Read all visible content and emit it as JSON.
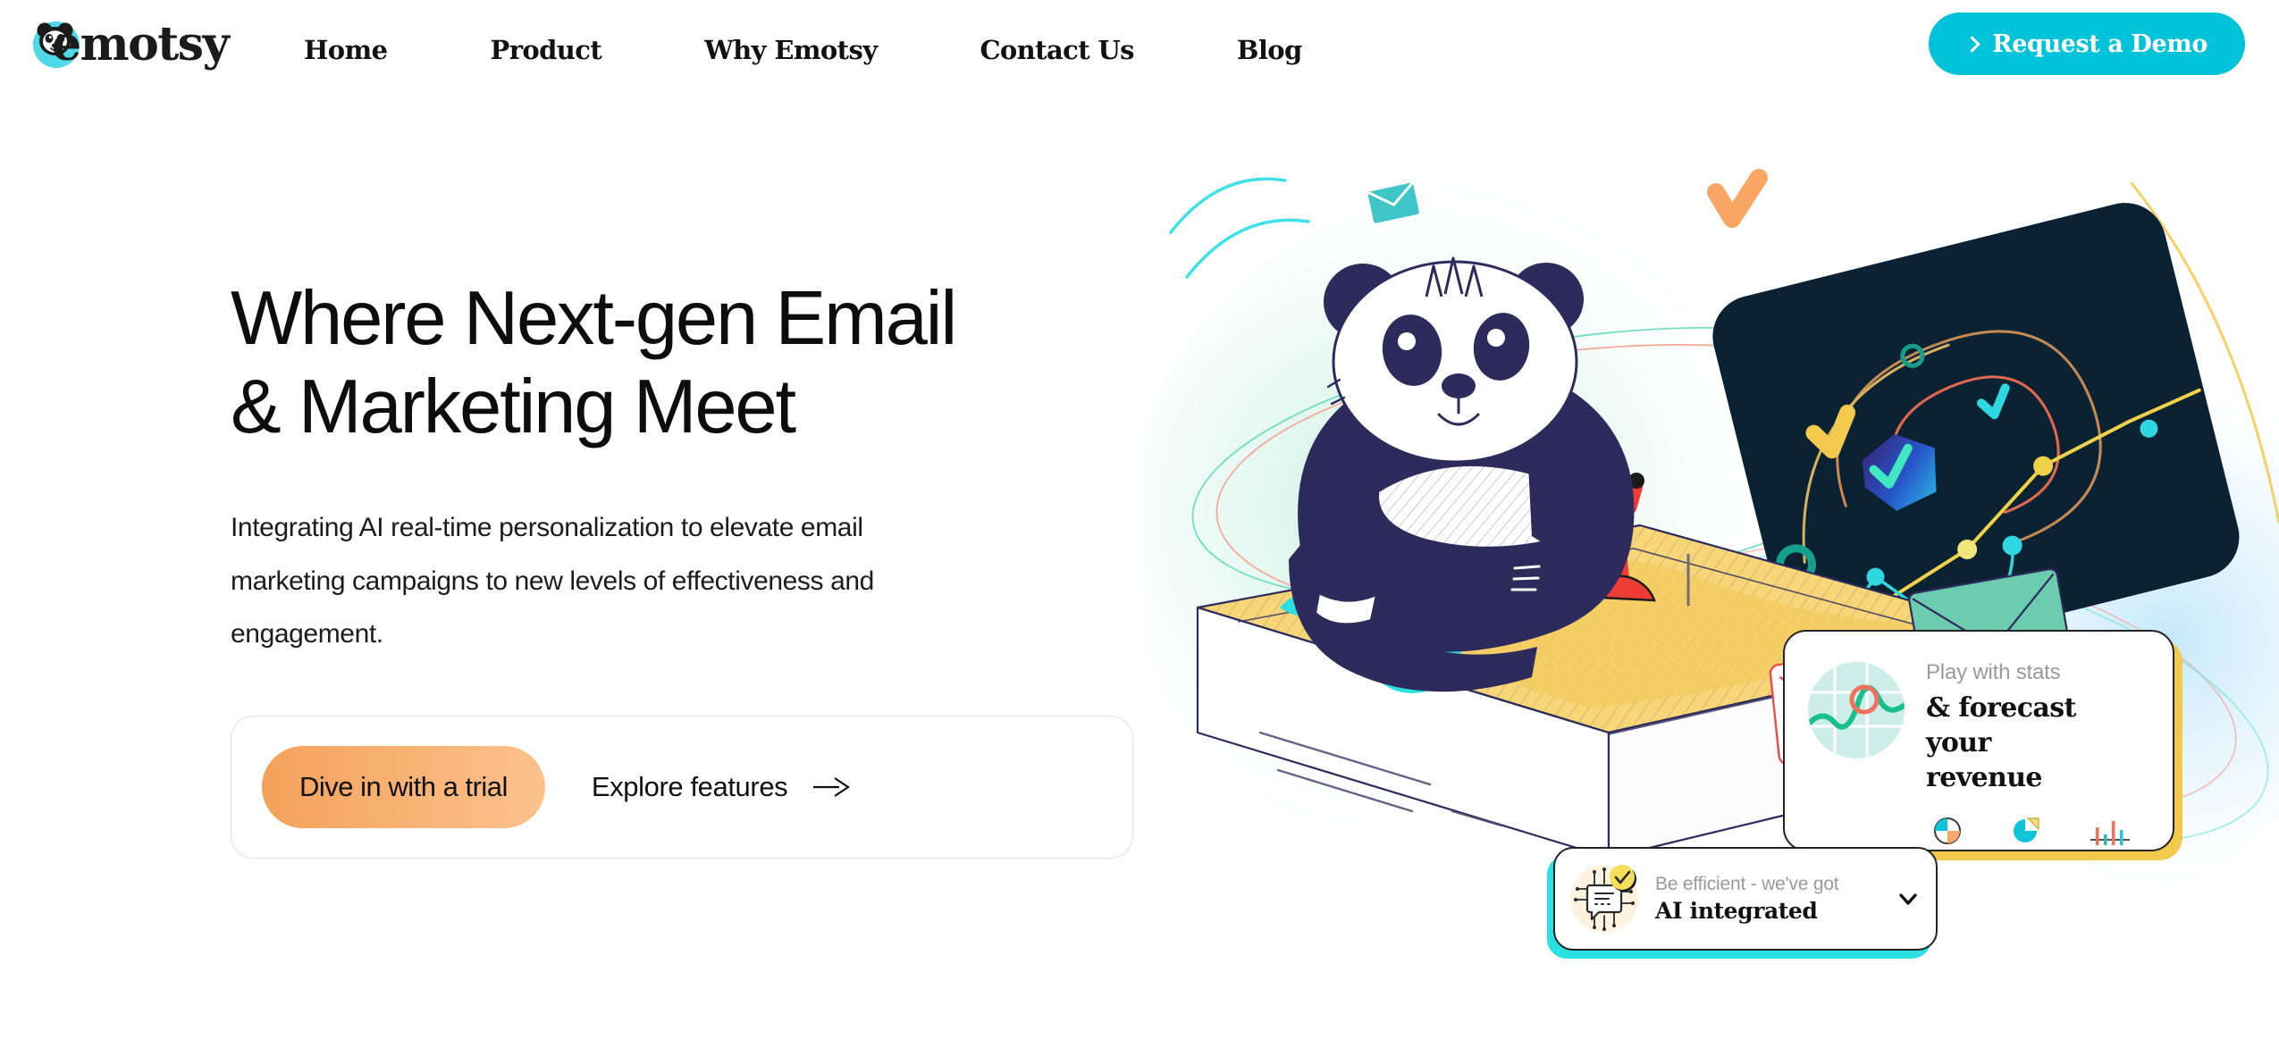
{
  "brand": {
    "name": "emotsy",
    "logo_icon": "panda-logo-icon",
    "accent_cyan": "#00C3D9",
    "accent_orange": "#F4A15A",
    "accent_yellow": "#F2C94C",
    "accent_teal": "#2BE0E0",
    "ink": "#0d0d0d"
  },
  "nav": {
    "items": [
      {
        "label": "Home"
      },
      {
        "label": "Product"
      },
      {
        "label": "Why Emotsy"
      },
      {
        "label": "Contact Us"
      },
      {
        "label": "Blog"
      }
    ],
    "cta": {
      "label": "Request a Demo",
      "icon": "chevron-right-icon"
    }
  },
  "hero": {
    "headline": "Where Next-gen Email\n & Marketing Meet",
    "subtext": "Integrating AI real-time personalization to elevate email\nmarketing campaigns to new levels of effectiveness and\nengagement.",
    "primary_cta": "Dive in with a trial",
    "secondary_cta": "Explore features",
    "secondary_cta_icon": "arrow-right-icon"
  },
  "cards": {
    "stats": {
      "kicker": "Play with stats",
      "title": "& forecast your\nrevenue",
      "thumb_icon": "line-chart-circle-icon",
      "mini_icons": [
        "donut-chart-icon",
        "pie-chart-icon",
        "bar-chart-icon"
      ],
      "shadow_color": "#F2C94C"
    },
    "ai": {
      "kicker": "Be efficient - we've got",
      "title": "AI integrated",
      "thumb_icon": "ai-chip-chat-icon",
      "badge_icon": "check-badge-icon",
      "expand_icon": "chevron-down-icon",
      "shadow_color": "#2BE0E0"
    }
  },
  "illustration": {
    "name": "panda-email-marketing-illustration",
    "elements": [
      "panda-character",
      "open-box",
      "dark-network-card",
      "envelopes",
      "orbit-ellipses",
      "chart-shapes"
    ]
  }
}
